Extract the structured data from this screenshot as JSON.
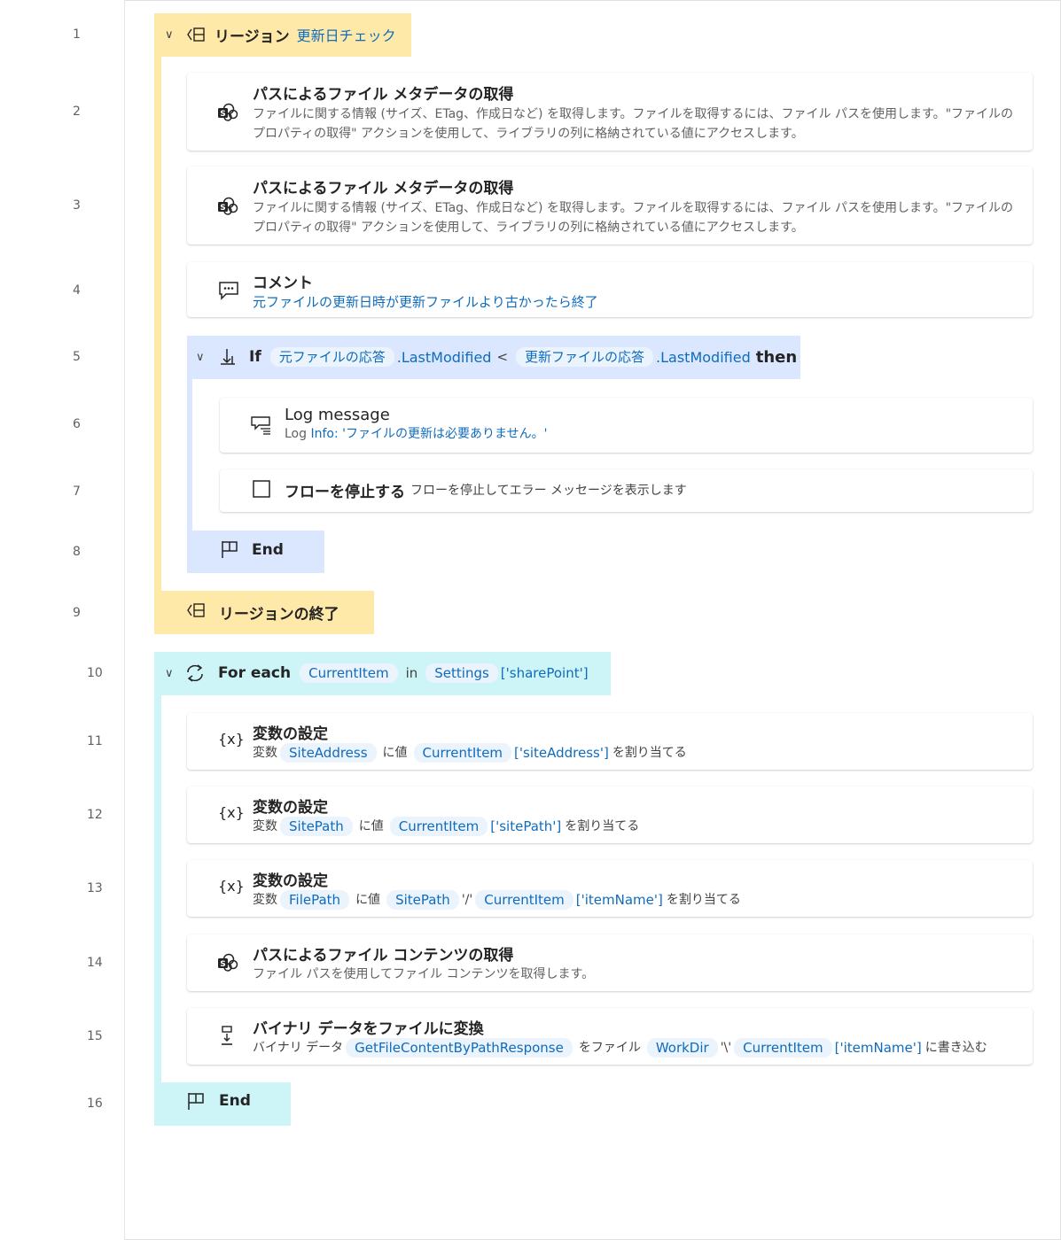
{
  "line_numbers": [
    "1",
    "2",
    "3",
    "4",
    "5",
    "6",
    "7",
    "8",
    "9",
    "10",
    "11",
    "12",
    "13",
    "14",
    "15",
    "16"
  ],
  "region": {
    "label": "リージョン",
    "name": "更新日チェック",
    "end_label": "リージョンの終了"
  },
  "metadata_action": {
    "title": "パスによるファイル メタデータの取得",
    "desc_line1": "ファイルに関する情報 (サイズ、ETag、作成日など) を取得します。ファイルを取得するには、ファイル パスを使用します。\"ファイルの",
    "desc_line2": "プロパティの取得\" アクションを使用して、ライブラリの列に格納されている値にアクセスします。"
  },
  "comment": {
    "title": "コメント",
    "text": "元ファイルの更新日時が更新ファイルより古かったら終了"
  },
  "if_block": {
    "keyword": "If",
    "var1": "元ファイルの応答",
    "prop1": ".LastModified",
    "op": "<",
    "var2": "更新ファイルの応答",
    "prop2": ".LastModified",
    "then": "then",
    "end_label": "End"
  },
  "log": {
    "title": "Log message",
    "prefix": "Log",
    "level": "Info:",
    "message": "'ファイルの更新は必要ありません。'"
  },
  "stop": {
    "title": "フローを停止する",
    "desc": "フローを停止してエラー メッセージを表示します"
  },
  "foreach": {
    "keyword": "For each",
    "item": "CurrentItem",
    "in": "in",
    "source": "Settings",
    "index": "['sharePoint']",
    "end_label": "End"
  },
  "setvar": {
    "title": "変数の設定",
    "var_label": "変数",
    "value_label": "に値",
    "assign_label": "を割り当てる"
  },
  "setvar1": {
    "var": "SiteAddress",
    "value_var": "CurrentItem",
    "value_index": "['siteAddress']"
  },
  "setvar2": {
    "var": "SitePath",
    "value_var": "CurrentItem",
    "value_index": "['sitePath']"
  },
  "setvar3": {
    "var": "FilePath",
    "value_var1": "SitePath",
    "sep": "'/'",
    "value_var2": "CurrentItem",
    "value_index": "['itemName']"
  },
  "content_action": {
    "title": "パスによるファイル コンテンツの取得",
    "desc": "ファイル パスを使用してファイル コンテンツを取得します。"
  },
  "binary_action": {
    "title": "バイナリ データをファイルに変換",
    "prefix": "バイナリ データ",
    "var": "GetFileContentByPathResponse",
    "mid": "をファイル",
    "dir": "WorkDir",
    "sep": "'\\'",
    "item": "CurrentItem",
    "index": "['itemName']",
    "suffix": "に書き込む"
  },
  "colors": {
    "region": "#ffe9a8",
    "if": "#dbe7ff",
    "foreach": "#cdf4f7",
    "token_bg": "#ebf3fc",
    "token_text": "#0f6cbd"
  }
}
